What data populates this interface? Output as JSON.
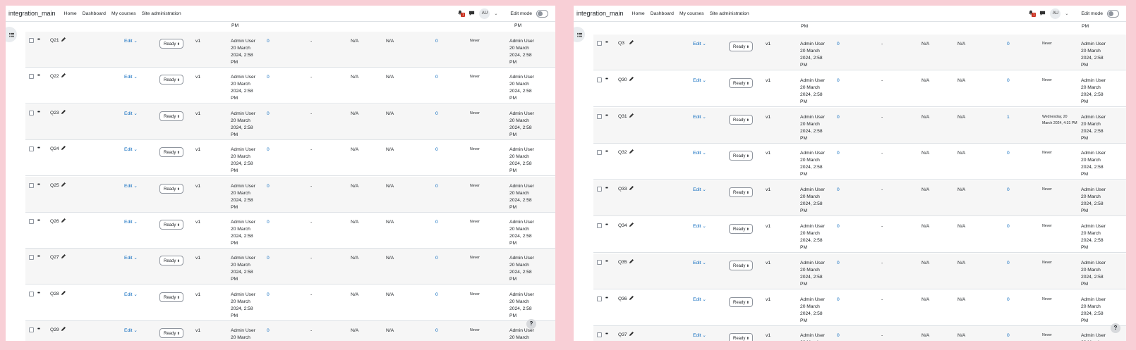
{
  "colors": {
    "background": "#f8cfd6",
    "link": "#0f6cbf",
    "badge": "#ca3120"
  },
  "icons": [
    "bell-icon",
    "chat-icon",
    "chevron-down-icon",
    "drawer-toggle-icon",
    "pencil-icon",
    "drag-icon",
    "help-icon"
  ],
  "windows": [
    {
      "brand": "integration_main",
      "nav": [
        "Home",
        "Dashboard",
        "My courses",
        "Site administration"
      ],
      "avatar": "AU",
      "badge": "1",
      "edit_mode_label": "Edit mode",
      "top_partial": [
        "PM",
        "PM"
      ],
      "rows": [
        {
          "name": "Q21",
          "edit": "Edit",
          "status": "Ready",
          "version": "v1",
          "created": [
            "Admin User",
            "20 March",
            "2024, 2:58",
            "PM"
          ],
          "comments": "0",
          "facility": "-",
          "discrimination": "N/A",
          "needs_checking": "N/A",
          "usage": "0",
          "last_used": "Never",
          "modified": [
            "Admin User",
            "20 March",
            "2024, 2:58",
            "PM"
          ]
        },
        {
          "name": "Q22",
          "edit": "Edit",
          "status": "Ready",
          "version": "v1",
          "created": [
            "Admin User",
            "20 March",
            "2024, 2:58",
            "PM"
          ],
          "comments": "0",
          "facility": "-",
          "discrimination": "N/A",
          "needs_checking": "N/A",
          "usage": "0",
          "last_used": "Never",
          "modified": [
            "Admin User",
            "20 March",
            "2024, 2:58",
            "PM"
          ]
        },
        {
          "name": "Q23",
          "edit": "Edit",
          "status": "Ready",
          "version": "v1",
          "created": [
            "Admin User",
            "20 March",
            "2024, 2:58",
            "PM"
          ],
          "comments": "0",
          "facility": "-",
          "discrimination": "N/A",
          "needs_checking": "N/A",
          "usage": "0",
          "last_used": "Never",
          "modified": [
            "Admin User",
            "20 March",
            "2024, 2:58",
            "PM"
          ]
        },
        {
          "name": "Q24",
          "edit": "Edit",
          "status": "Ready",
          "version": "v1",
          "created": [
            "Admin User",
            "20 March",
            "2024, 2:58",
            "PM"
          ],
          "comments": "0",
          "facility": "-",
          "discrimination": "N/A",
          "needs_checking": "N/A",
          "usage": "0",
          "last_used": "Never",
          "modified": [
            "Admin User",
            "20 March",
            "2024, 2:58",
            "PM"
          ]
        },
        {
          "name": "Q25",
          "edit": "Edit",
          "status": "Ready",
          "version": "v1",
          "created": [
            "Admin User",
            "20 March",
            "2024, 2:58",
            "PM"
          ],
          "comments": "0",
          "facility": "-",
          "discrimination": "N/A",
          "needs_checking": "N/A",
          "usage": "0",
          "last_used": "Never",
          "modified": [
            "Admin User",
            "20 March",
            "2024, 2:58",
            "PM"
          ]
        },
        {
          "name": "Q26",
          "edit": "Edit",
          "status": "Ready",
          "version": "v1",
          "created": [
            "Admin User",
            "20 March",
            "2024, 2:58",
            "PM"
          ],
          "comments": "0",
          "facility": "-",
          "discrimination": "N/A",
          "needs_checking": "N/A",
          "usage": "0",
          "last_used": "Never",
          "modified": [
            "Admin User",
            "20 March",
            "2024, 2:58",
            "PM"
          ]
        },
        {
          "name": "Q27",
          "edit": "Edit",
          "status": "Ready",
          "version": "v1",
          "created": [
            "Admin User",
            "20 March",
            "2024, 2:58",
            "PM"
          ],
          "comments": "0",
          "facility": "-",
          "discrimination": "N/A",
          "needs_checking": "N/A",
          "usage": "0",
          "last_used": "Never",
          "modified": [
            "Admin User",
            "20 March",
            "2024, 2:58",
            "PM"
          ]
        },
        {
          "name": "Q28",
          "edit": "Edit",
          "status": "Ready",
          "version": "v1",
          "created": [
            "Admin User",
            "20 March",
            "2024, 2:58",
            "PM"
          ],
          "comments": "0",
          "facility": "-",
          "discrimination": "N/A",
          "needs_checking": "N/A",
          "usage": "0",
          "last_used": "Never",
          "modified": [
            "Admin User",
            "20 March",
            "2024, 2:58",
            "PM"
          ]
        },
        {
          "name": "Q29",
          "edit": "Edit",
          "status": "Ready",
          "version": "v1",
          "created": [
            "Admin User",
            "20 March",
            "",
            ""
          ],
          "comments": "0",
          "facility": "-",
          "discrimination": "N/A",
          "needs_checking": "N/A",
          "usage": "0",
          "last_used": "Never",
          "modified": [
            "Admin User",
            "20 March",
            "",
            ""
          ]
        }
      ],
      "help": "?"
    },
    {
      "brand": "integration_main",
      "nav": [
        "Home",
        "Dashboard",
        "My courses",
        "Site administration"
      ],
      "avatar": "AU",
      "badge": "1",
      "edit_mode_label": "Edit mode",
      "top_partial": [
        "PM",
        "PM"
      ],
      "rows": [
        {
          "name": "Q3",
          "edit": "Edit",
          "status": "Ready",
          "version": "v1",
          "created": [
            "Admin User",
            "20 March",
            "2024, 2:58",
            "PM"
          ],
          "comments": "0",
          "facility": "-",
          "discrimination": "N/A",
          "needs_checking": "N/A",
          "usage": "0",
          "last_used": "Never",
          "modified": [
            "Admin User",
            "20 March",
            "2024, 2:58",
            "PM"
          ]
        },
        {
          "name": "Q30",
          "edit": "Edit",
          "status": "Ready",
          "version": "v1",
          "created": [
            "Admin User",
            "20 March",
            "2024, 2:58",
            "PM"
          ],
          "comments": "0",
          "facility": "-",
          "discrimination": "N/A",
          "needs_checking": "N/A",
          "usage": "0",
          "last_used": "Never",
          "modified": [
            "Admin User",
            "20 March",
            "2024, 2:58",
            "PM"
          ]
        },
        {
          "name": "Q31",
          "edit": "Edit",
          "status": "Ready",
          "version": "v1",
          "created": [
            "Admin User",
            "20 March",
            "2024, 2:58",
            "PM"
          ],
          "comments": "0",
          "facility": "-",
          "discrimination": "N/A",
          "needs_checking": "N/A",
          "usage": "1",
          "last_used": "Wednesday, 20 March 2024, 4:31 PM",
          "modified": [
            "Admin User",
            "20 March",
            "2024, 2:58",
            "PM"
          ]
        },
        {
          "name": "Q32",
          "edit": "Edit",
          "status": "Ready",
          "version": "v1",
          "created": [
            "Admin User",
            "20 March",
            "2024, 2:58",
            "PM"
          ],
          "comments": "0",
          "facility": "-",
          "discrimination": "N/A",
          "needs_checking": "N/A",
          "usage": "0",
          "last_used": "Never",
          "modified": [
            "Admin User",
            "20 March",
            "2024, 2:58",
            "PM"
          ]
        },
        {
          "name": "Q33",
          "edit": "Edit",
          "status": "Ready",
          "version": "v1",
          "created": [
            "Admin User",
            "20 March",
            "2024, 2:58",
            "PM"
          ],
          "comments": "0",
          "facility": "-",
          "discrimination": "N/A",
          "needs_checking": "N/A",
          "usage": "0",
          "last_used": "Never",
          "modified": [
            "Admin User",
            "20 March",
            "2024, 2:58",
            "PM"
          ]
        },
        {
          "name": "Q34",
          "edit": "Edit",
          "status": "Ready",
          "version": "v1",
          "created": [
            "Admin User",
            "20 March",
            "2024, 2:58",
            "PM"
          ],
          "comments": "0",
          "facility": "-",
          "discrimination": "N/A",
          "needs_checking": "N/A",
          "usage": "0",
          "last_used": "Never",
          "modified": [
            "Admin User",
            "20 March",
            "2024, 2:58",
            "PM"
          ]
        },
        {
          "name": "Q35",
          "edit": "Edit",
          "status": "Ready",
          "version": "v1",
          "created": [
            "Admin User",
            "20 March",
            "2024, 2:58",
            "PM"
          ],
          "comments": "0",
          "facility": "-",
          "discrimination": "N/A",
          "needs_checking": "N/A",
          "usage": "0",
          "last_used": "Never",
          "modified": [
            "Admin User",
            "20 March",
            "2024, 2:58",
            "PM"
          ]
        },
        {
          "name": "Q36",
          "edit": "Edit",
          "status": "Ready",
          "version": "v1",
          "created": [
            "Admin User",
            "20 March",
            "2024, 2:58",
            "PM"
          ],
          "comments": "0",
          "facility": "-",
          "discrimination": "N/A",
          "needs_checking": "N/A",
          "usage": "0",
          "last_used": "Never",
          "modified": [
            "Admin User",
            "20 March",
            "2024, 2:58",
            "PM"
          ]
        },
        {
          "name": "Q37",
          "edit": "Edit",
          "status": "Ready",
          "version": "v1",
          "created": [
            "Admin User",
            "20 March",
            "",
            ""
          ],
          "comments": "0",
          "facility": "-",
          "discrimination": "N/A",
          "needs_checking": "N/A",
          "usage": "0",
          "last_used": "Never",
          "modified": [
            "Admin User",
            "20 March",
            "",
            ""
          ]
        }
      ],
      "help": "?"
    }
  ]
}
